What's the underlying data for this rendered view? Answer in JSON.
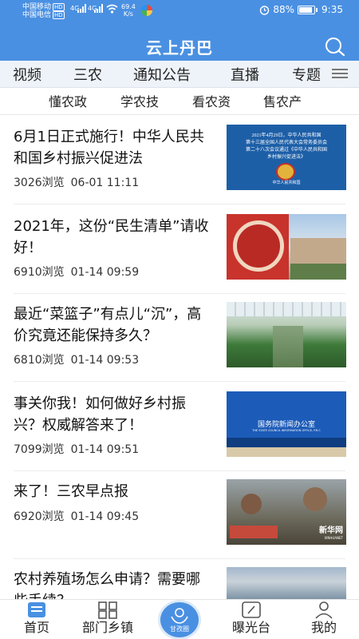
{
  "status_bar": {
    "carrier1": "中国移动",
    "carrier2": "中国电信",
    "hd": "HD",
    "net1": "4G",
    "net2": "4G",
    "speed_value": "69.4",
    "speed_unit": "K/s",
    "battery": "88%",
    "time": "9:35"
  },
  "header": {
    "title": "云上丹巴"
  },
  "tabs": [
    "视频",
    "三农",
    "通知公告",
    "直播",
    "专题"
  ],
  "subtabs": [
    "懂农政",
    "学农技",
    "看农资",
    "售农产"
  ],
  "news": [
    {
      "title": "6月1日正式施行！中华人民共和国乡村振兴促进法",
      "views": "3026浏览",
      "time": "06-01 11:11",
      "thumb_lines": [
        "2021年4月29日，中华人民共和国",
        "第十三届全国人民代表大会常务委员会",
        "第二十八次会议通过《中华人民共和国",
        "乡村振兴促进法》",
        "中华人民共和国",
        "全国人大常委会"
      ]
    },
    {
      "title": "2021年，这份“民生清单”请收好！",
      "views": "6910浏览",
      "time": "01-14 09:59"
    },
    {
      "title": "最近“菜篮子”有点儿“沉”，高价究竟还能保持多久？",
      "views": "6810浏览",
      "time": "01-14 09:53"
    },
    {
      "title": "事关你我！如何做好乡村振兴？权威解答来了！",
      "views": "7099浏览",
      "time": "01-14 09:51",
      "thumb_lines": [
        "国务院新闻办公室",
        "THE STATE COUNCIL INFORMATION OFFICE, P.R.C"
      ]
    },
    {
      "title": "来了！三农早点报",
      "views": "6920浏览",
      "time": "01-14 09:45",
      "thumb_lines": [
        "新华网",
        "XINHUANET"
      ]
    },
    {
      "title": "农村养殖场怎么申请？需要哪些手续？",
      "views": "",
      "time": ""
    }
  ],
  "bottom_nav": {
    "home": "首页",
    "dept": "部门乡镇",
    "center": "甘孜圈",
    "exposure": "曝光台",
    "mine": "我的"
  },
  "colors": {
    "brand": "#4a90e2",
    "tab_bg": "#eef3f9"
  }
}
